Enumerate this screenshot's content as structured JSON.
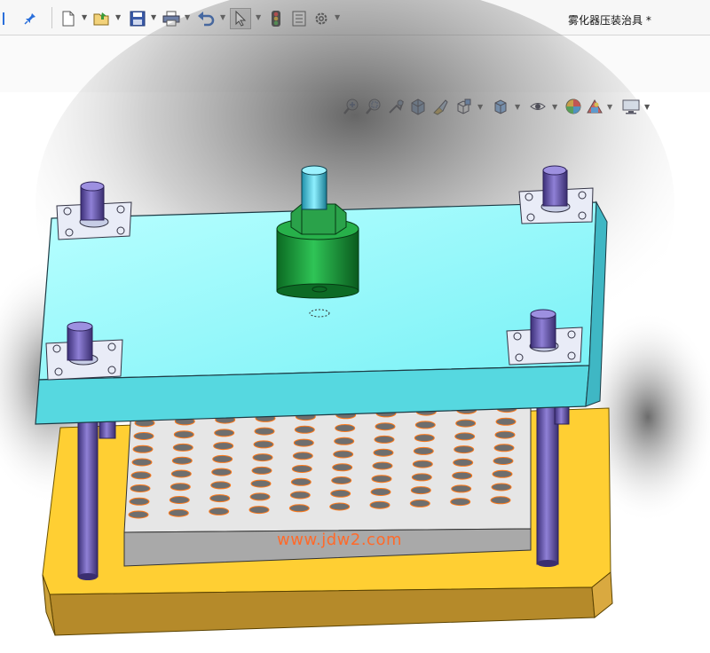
{
  "toolbar": {
    "title": "雾化器压装治具 *"
  },
  "watermark": {
    "text": "www.jdw2.com"
  },
  "colors": {
    "top_plate": "#7ff7fb",
    "base_plate": "#ffcf33",
    "pillars": "#6f5fb0",
    "cylinder": "#19a33a",
    "fixture_block": "#d9d9d9",
    "hole_outline": "#ff7a1a"
  },
  "icons": {
    "left_pin": "pin-icon",
    "new": "new-document-icon",
    "open": "open-folder-icon",
    "save": "save-icon",
    "print": "print-icon",
    "undo": "undo-icon",
    "select": "select-arrow-icon",
    "rebuild": "traffic-light-icon",
    "file_props": "file-properties-icon",
    "options": "gear-icon",
    "zoom_fit": "zoom-to-fit-icon",
    "zoom_area": "zoom-area-icon",
    "previous_view": "previous-view-icon",
    "section_view": "section-view-icon",
    "dynamic_annotation": "dynamic-annotation-icon",
    "view_orientation": "view-orientation-icon",
    "display_style": "display-style-icon",
    "hide_show": "hide-show-icon",
    "edit_appearance": "edit-appearance-icon",
    "apply_scene": "apply-scene-icon",
    "view_settings": "view-settings-icon"
  }
}
